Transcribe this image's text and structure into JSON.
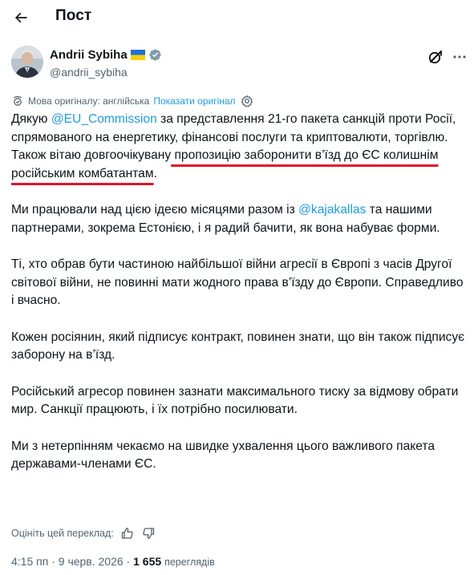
{
  "header": {
    "title": "Пост"
  },
  "author": {
    "name": "Andrii Sybiha",
    "handle": "@andrii_sybiha"
  },
  "translation": {
    "label": "Мова оригіналу: англійська",
    "show_original": "Показати оригінал"
  },
  "post": {
    "p1": {
      "a": "Дякую ",
      "mention": "@EU_Commission",
      "b": " за представлення 21-го пакета санкцій проти Росії, спрямованого на енергетику, фінансові послуги та криптовалюти, торгівлю. Також вітаю довгоочікувану",
      "highlight": " пропозицію заборонити в’їзд до ЄС колишнім російським комбатантам",
      "c": "."
    },
    "p2": {
      "a": "Ми працювали над цією ідеєю місяцями разом із ",
      "mention": "@kajakallas",
      "b": " та нашими партнерами, зокрема Естонією, і я радий бачити, як вона набуває форми."
    },
    "p3": "Ті, хто обрав бути частиною найбільшої війни агресії в Європі з часів Другої світової війни, не повинні мати жодного права в’їзду до Європи. Справедливо і вчасно.",
    "p4": "Кожен росіянин, який підписує контракт, повинен знати, що він також підписує заборону на в’їзд.",
    "p5": "Російський агресор повинен зазнати максимального тиску за відмову обрати мир. Санкції працюють, і їх потрібно посилювати.",
    "p6": "Ми з нетерпінням чекаємо на швидке ухвалення цього важливого пакета державами-членами ЄС."
  },
  "rating": {
    "label": "Оцініть цей переклад:"
  },
  "meta": {
    "time": "4:15 пп",
    "separator": " · ",
    "date": "9 черв. 2026",
    "views_count": "1 655",
    "views_label": "переглядів"
  },
  "colors": {
    "accent": "#1d9bf0",
    "underline": "#e3142b",
    "secondary_text": "#536471"
  }
}
